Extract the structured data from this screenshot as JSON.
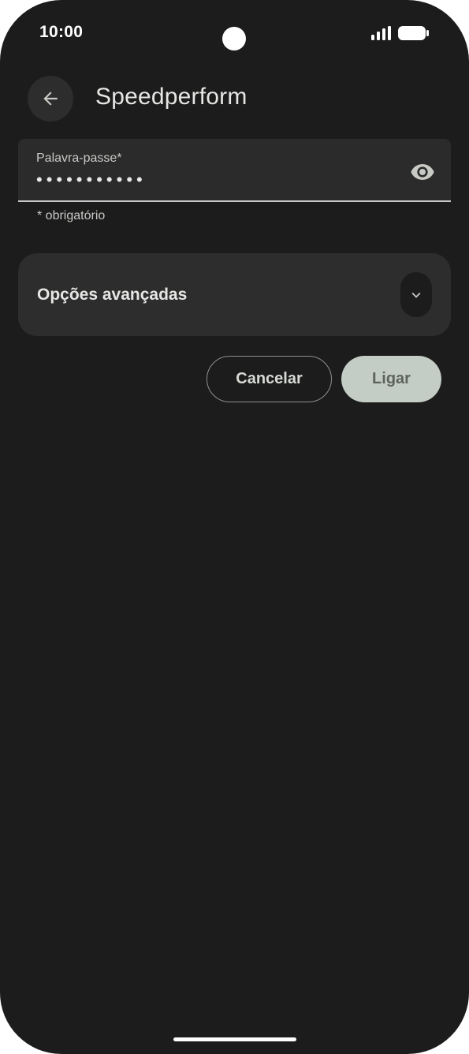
{
  "status_bar": {
    "time": "10:00",
    "icons": [
      "signal-icon",
      "battery-icon"
    ]
  },
  "header": {
    "title": "Speedperform",
    "back_icon": "arrow-left-icon"
  },
  "password_field": {
    "label": "Palavra-passe*",
    "value": "•••••••••••",
    "toggle_icon": "eye-icon"
  },
  "helper": {
    "required_note": "* obrigatório"
  },
  "advanced": {
    "label": "Opções avançadas",
    "expand_icon": "chevron-down-icon"
  },
  "actions": {
    "cancel_label": "Cancelar",
    "connect_label": "Ligar"
  },
  "colors": {
    "background": "#1b1c1b",
    "surface": "#2c2d2c",
    "primary_container": "#c3ccc5",
    "outline": "#8e918d"
  }
}
